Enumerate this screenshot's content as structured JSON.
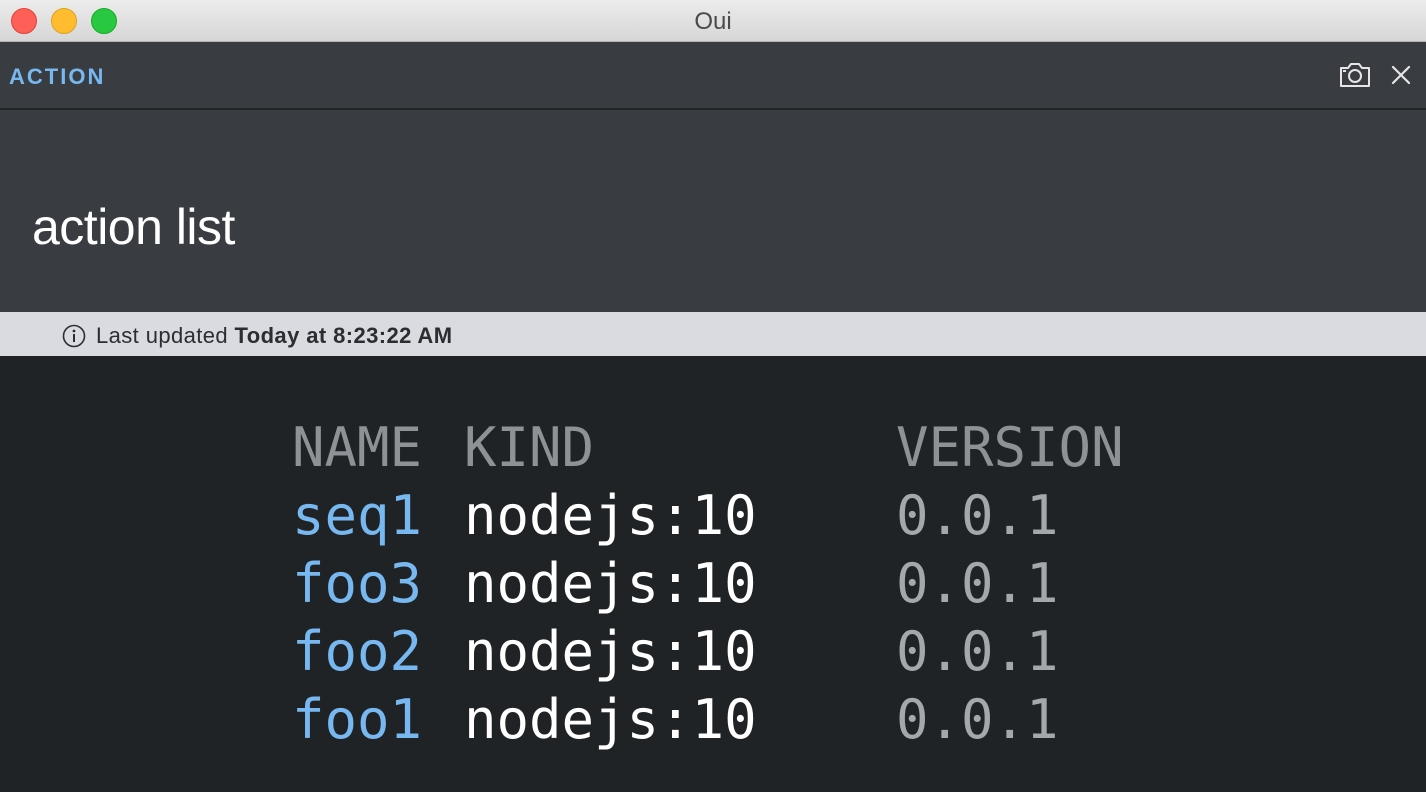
{
  "window": {
    "title": "Oui"
  },
  "header": {
    "label": "ACTION"
  },
  "page": {
    "title": "action list"
  },
  "status": {
    "prefix": "Last updated",
    "timestamp": "Today at 8:23:22 AM"
  },
  "table": {
    "columns": [
      "NAME",
      "KIND",
      "VERSION"
    ],
    "rows": [
      {
        "name": "seq1",
        "kind": "nodejs:10",
        "version": "0.0.1"
      },
      {
        "name": "foo3",
        "kind": "nodejs:10",
        "version": "0.0.1"
      },
      {
        "name": "foo2",
        "kind": "nodejs:10",
        "version": "0.0.1"
      },
      {
        "name": "foo1",
        "kind": "nodejs:10",
        "version": "0.0.1"
      }
    ]
  },
  "icons": {
    "window_close": "close-icon",
    "window_minimize": "minimize-icon",
    "window_maximize": "maximize-icon",
    "snapshot": "camera-icon",
    "close_view": "close-icon",
    "info": "info-icon"
  },
  "colors": {
    "accent": "#78b8f0",
    "header_bg": "#393d42",
    "output_bg": "#202326",
    "status_bg": "#d9dbe1"
  }
}
